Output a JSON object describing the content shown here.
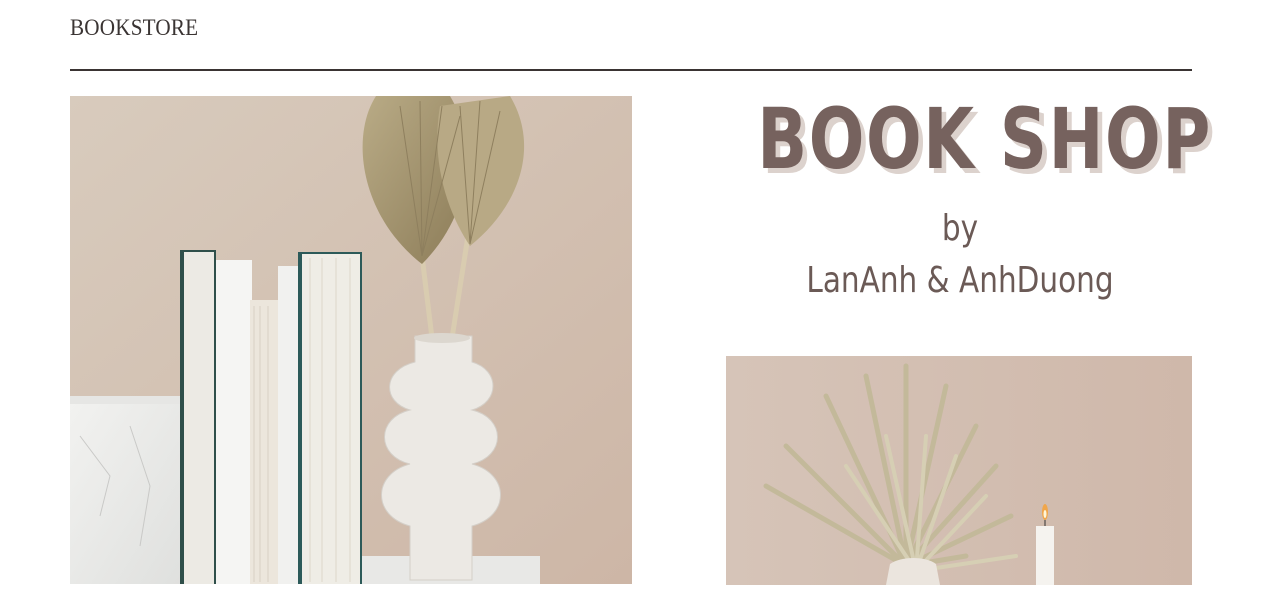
{
  "header": {
    "brand": "BOOKSTORE"
  },
  "hero": {
    "title": "BOOK SHOP",
    "by": "by",
    "authors": "LanAnh & AnhDuong"
  },
  "colors": {
    "title": "#76625e",
    "title_shadow": "#dcd2cd",
    "text": "#6b5a56",
    "rule": "#3a3433",
    "photo_bg": "#d3c5b8"
  },
  "images": [
    {
      "icon": "books-and-vase-photo"
    },
    {
      "icon": "palm-leaf-and-candle-photo"
    }
  ]
}
